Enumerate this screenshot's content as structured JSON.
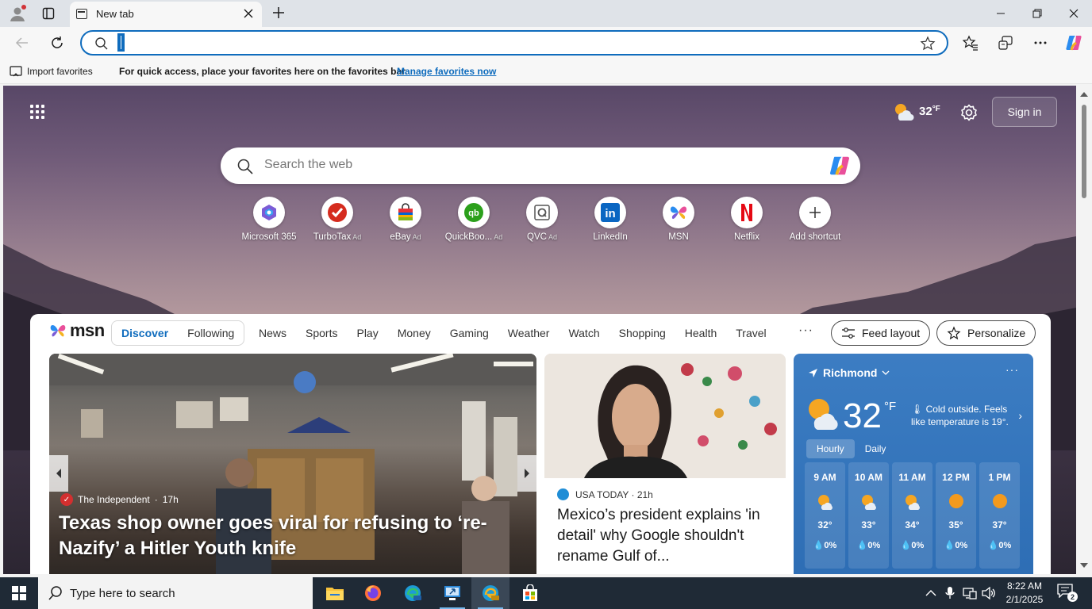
{
  "browser": {
    "tab_title": "New tab",
    "address_value": "",
    "favorites_bar": {
      "import_label": "Import favorites",
      "message": "For quick access, place your favorites here on the favorites bar.",
      "link": "Manage favorites now"
    }
  },
  "ntp": {
    "weather_temp": "32",
    "weather_unit": "°F",
    "signin_label": "Sign in",
    "search_placeholder": "Search the web",
    "shortcuts": [
      {
        "label": "Microsoft 365",
        "ad": ""
      },
      {
        "label": "TurboTax",
        "ad": "Ad"
      },
      {
        "label": "eBay",
        "ad": "Ad"
      },
      {
        "label": "QuickBoo...",
        "ad": "Ad"
      },
      {
        "label": "QVC",
        "ad": "Ad"
      },
      {
        "label": "LinkedIn",
        "ad": ""
      },
      {
        "label": "MSN",
        "ad": ""
      },
      {
        "label": "Netflix",
        "ad": ""
      },
      {
        "label": "Add shortcut",
        "ad": ""
      }
    ]
  },
  "feed": {
    "logo_text": "msn",
    "discover": "Discover",
    "following": "Following",
    "categories": [
      "News",
      "Sports",
      "Play",
      "Money",
      "Gaming",
      "Weather",
      "Watch",
      "Shopping",
      "Health",
      "Travel"
    ],
    "more": "···",
    "feed_layout": "Feed layout",
    "personalize": "Personalize",
    "hero": {
      "source": "The Independent",
      "age": "17h",
      "title": "Texas shop owner goes viral for refusing to ‘re-Nazify’ a Hitler Youth knife"
    },
    "story2": {
      "source": "USA TODAY",
      "age": "21h",
      "title": "Mexico’s president explains 'in detail' why Google shouldn't rename Gulf of..."
    },
    "weather": {
      "location": "Richmond",
      "temp": "32",
      "unit": "°F",
      "note": "Cold outside. Feels like temperature is 19°.",
      "tab_hourly": "Hourly",
      "tab_daily": "Daily",
      "hours": [
        {
          "time": "9 AM",
          "temp": "32°",
          "precip": "0%",
          "icon": "partly-cloudy"
        },
        {
          "time": "10 AM",
          "temp": "33°",
          "precip": "0%",
          "icon": "partly-cloudy"
        },
        {
          "time": "11 AM",
          "temp": "34°",
          "precip": "0%",
          "icon": "partly-cloudy"
        },
        {
          "time": "12 PM",
          "temp": "35°",
          "precip": "0%",
          "icon": "sunny"
        },
        {
          "time": "1 PM",
          "temp": "37°",
          "precip": "0%",
          "icon": "sunny"
        }
      ]
    }
  },
  "taskbar": {
    "search_placeholder": "Type here to search",
    "time": "8:22 AM",
    "date": "2/1/2025",
    "notification_count": "2"
  },
  "colors": {
    "accent": "#0f6cbd",
    "weather_card": "#3172bb",
    "taskbar": "#1f2a36"
  }
}
